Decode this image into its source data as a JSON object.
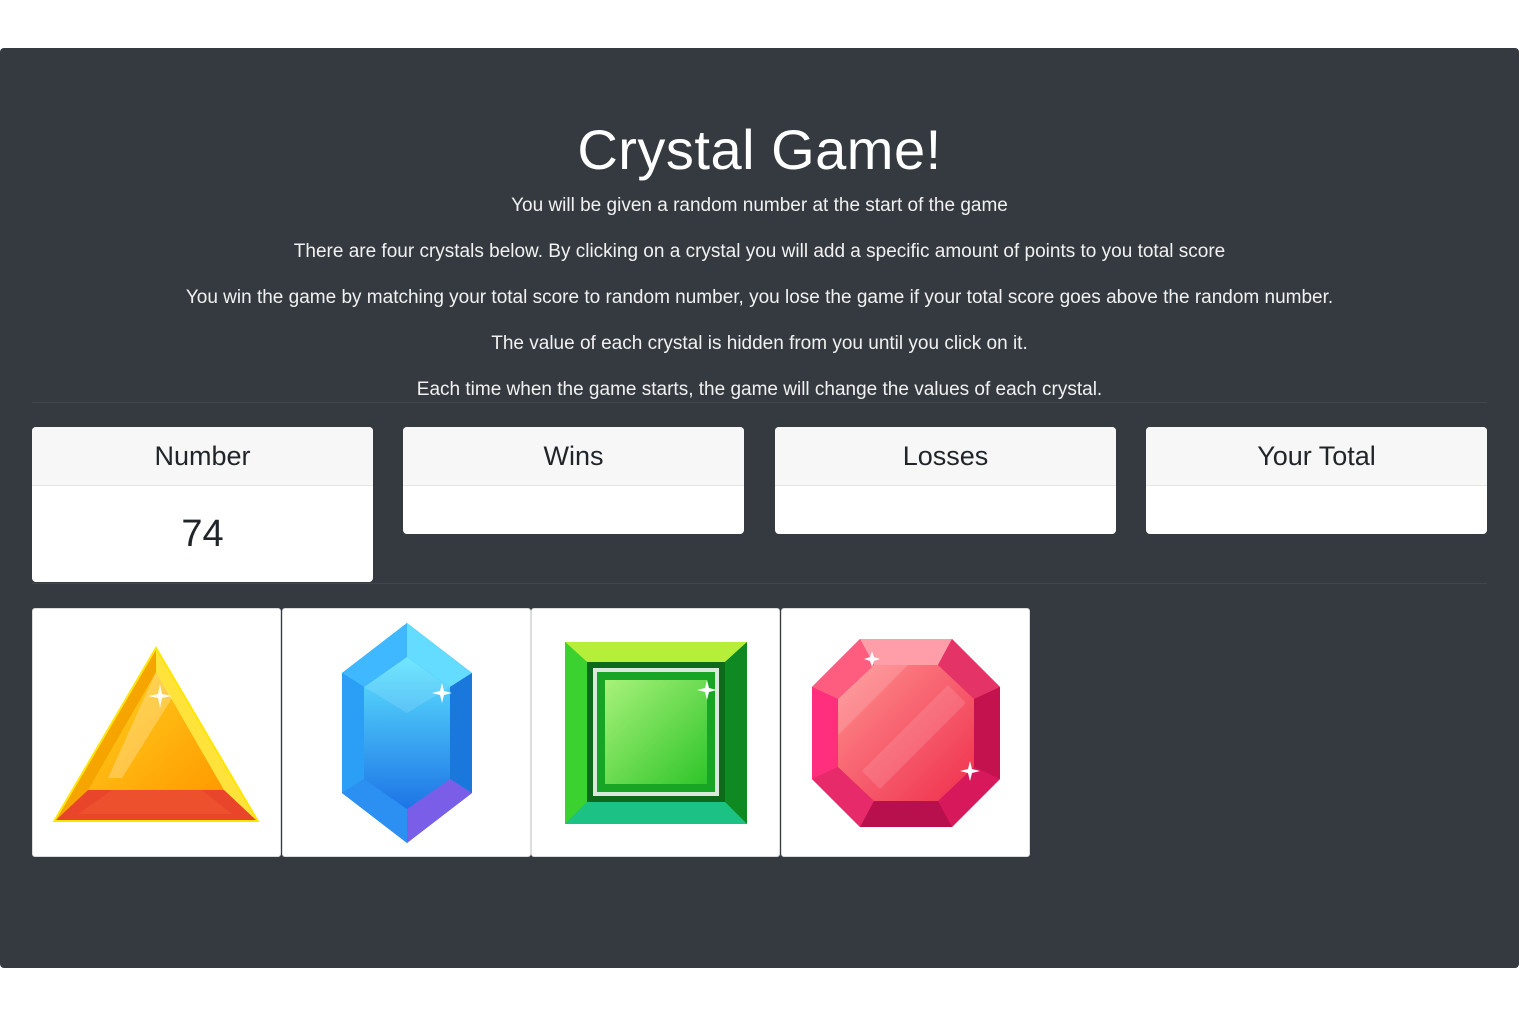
{
  "header": {
    "title": "Crystal Game!",
    "rules": [
      "You will be given a random number at the start of the game",
      "There are four crystals below. By clicking on a crystal you will add a specific amount of points to you total score",
      "You win the game by matching your total score to random number, you lose the game if your total score goes above the random number.",
      "The value of each crystal is hidden from you until you click on it.",
      "Each time when the game starts, the game will change the values of each crystal."
    ]
  },
  "stats": {
    "number": {
      "label": "Number",
      "value": "74"
    },
    "wins": {
      "label": "Wins",
      "value": ""
    },
    "losses": {
      "label": "Losses",
      "value": ""
    },
    "total": {
      "label": "Your Total",
      "value": ""
    }
  },
  "crystals": [
    {
      "icon": "yellow-triangle-crystal-icon",
      "color": "#f7b500"
    },
    {
      "icon": "blue-hexagon-crystal-icon",
      "color": "#1fa8ee"
    },
    {
      "icon": "green-square-crystal-icon",
      "color": "#2bc21f"
    },
    {
      "icon": "red-octagon-crystal-icon",
      "color": "#e8314f"
    }
  ],
  "colors": {
    "background": "#343a40",
    "card": "#ffffff",
    "card_header": "#f7f7f7"
  }
}
